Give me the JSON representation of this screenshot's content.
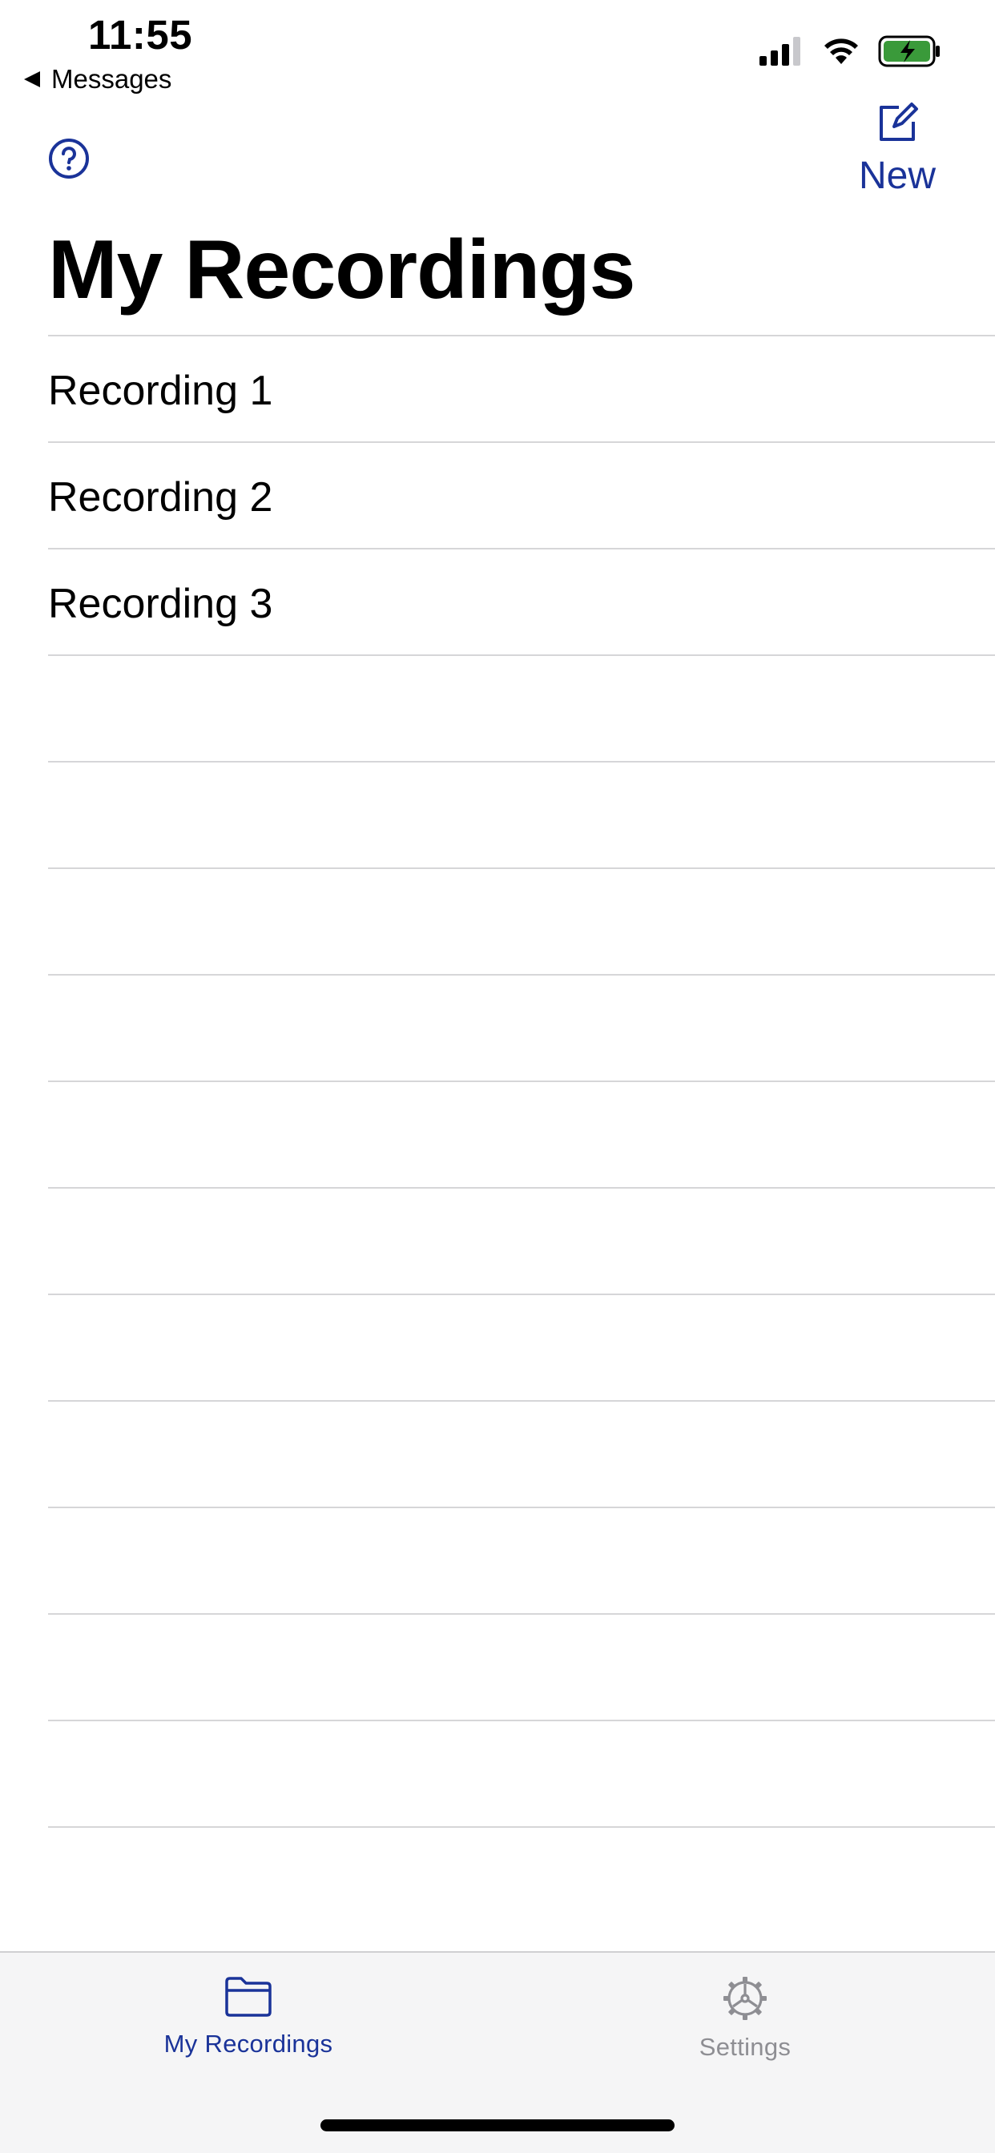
{
  "status_bar": {
    "time": "11:55",
    "back_label": "Messages"
  },
  "nav": {
    "new_label": "New",
    "title": "My Recordings"
  },
  "recordings": [
    {
      "label": "Recording 1"
    },
    {
      "label": "Recording 2"
    },
    {
      "label": "Recording 3"
    },
    {
      "label": ""
    },
    {
      "label": ""
    },
    {
      "label": ""
    },
    {
      "label": ""
    },
    {
      "label": ""
    },
    {
      "label": ""
    },
    {
      "label": ""
    },
    {
      "label": ""
    },
    {
      "label": ""
    },
    {
      "label": ""
    },
    {
      "label": ""
    },
    {
      "label": ""
    }
  ],
  "tab_bar": {
    "tabs": [
      {
        "label": "My Recordings",
        "icon": "folder-icon",
        "selected": true
      },
      {
        "label": "Settings",
        "icon": "gear-icon",
        "selected": false
      }
    ]
  },
  "colors": {
    "accent": "#1a3399",
    "inactive": "#8e8e93",
    "battery_fill": "#3a9a3a"
  }
}
